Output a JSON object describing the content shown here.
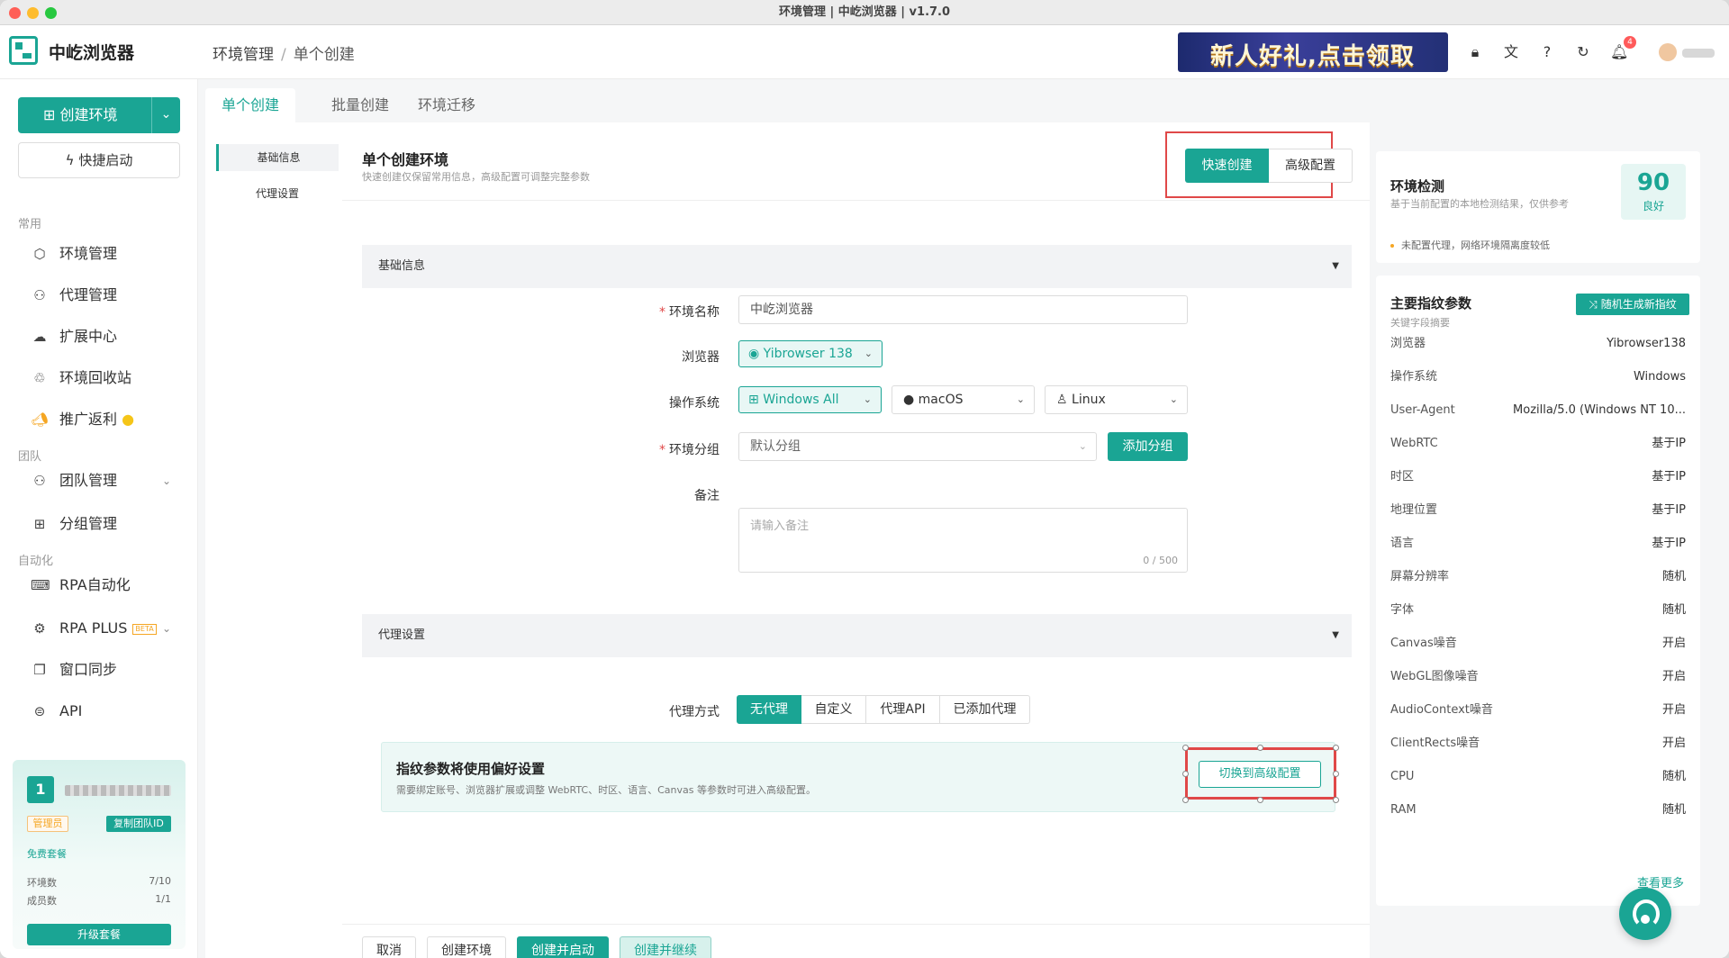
{
  "window": {
    "title": "环境管理 | 中屹浏览器 | v1.7.0"
  },
  "app": {
    "name": "中屹浏览器"
  },
  "breadcrumb": {
    "first": "环境管理",
    "sep": "/",
    "current": "单个创建"
  },
  "header": {
    "promo_text": "新人好礼,点击领取",
    "bell_count": "4"
  },
  "sidebar": {
    "create_label": "创建环境",
    "quick_label": "快捷启动",
    "sections": {
      "common": "常用",
      "team": "团队",
      "automation": "自动化"
    },
    "items": {
      "env": "环境管理",
      "proxy": "代理管理",
      "ext": "扩展中心",
      "recycle": "环境回收站",
      "promo": "推广返利",
      "team": "团队管理",
      "group": "分组管理",
      "rpa": "RPA自动化",
      "rpaplus": "RPA PLUS",
      "beta": "BETA",
      "sync": "窗口同步",
      "api": "API"
    },
    "team_card": {
      "num": "1",
      "role": "管理员",
      "copy": "复制团队ID",
      "plan": "免费套餐",
      "env_label": "环境数",
      "env_value": "7/10",
      "member_label": "成员数",
      "member_value": "1/1",
      "upgrade": "升级套餐"
    }
  },
  "tabs": [
    "单个创建",
    "批量创建",
    "环境迁移"
  ],
  "subnav": [
    "基础信息",
    "代理设置"
  ],
  "pane": {
    "title": "单个创建环境",
    "subtitle": "快速创建仅保留常用信息，高级配置可调整完整参数",
    "mode_quick": "快速创建",
    "mode_adv": "高级配置"
  },
  "basic": {
    "section": "基础信息",
    "name_label": "环境名称",
    "name_value": "中屹浏览器",
    "browser_label": "浏览器",
    "browser_value": "Yibrowser 138",
    "os_label": "操作系统",
    "os_win": "Windows All",
    "os_mac": "macOS",
    "os_linux": "Linux",
    "group_label": "环境分组",
    "group_value": "默认分组",
    "add_group": "添加分组",
    "note_label": "备注",
    "note_placeholder": "请输入备注",
    "note_count": "0 / 500"
  },
  "proxy": {
    "section": "代理设置",
    "mode_label": "代理方式",
    "options": [
      "无代理",
      "自定义",
      "代理API",
      "已添加代理"
    ],
    "notice_title": "指纹参数将使用偏好设置",
    "notice_sub": "需要绑定账号、浏览器扩展或调整 WebRTC、时区、语言、Canvas 等参数时可进入高级配置。",
    "switch_btn": "切换到高级配置"
  },
  "footer": {
    "cancel": "取消",
    "create": "创建环境",
    "create_launch": "创建并启动",
    "create_continue": "创建并继续"
  },
  "env_check": {
    "title": "环境检测",
    "subtitle": "基于当前配置的本地检测结果，仅供参考",
    "score": "90",
    "grade": "良好",
    "warning": "未配置代理，网络环境隔离度较低"
  },
  "fingerprint": {
    "title": "主要指纹参数",
    "subtitle": "关键字段摘要",
    "random_btn": "随机生成新指纹",
    "rows": [
      {
        "k": "浏览器",
        "v": "Yibrowser138"
      },
      {
        "k": "操作系统",
        "v": "Windows"
      },
      {
        "k": "User-Agent",
        "v": "Mozilla/5.0 (Windows NT 10..."
      },
      {
        "k": "WebRTC",
        "v": "基于IP"
      },
      {
        "k": "时区",
        "v": "基于IP"
      },
      {
        "k": "地理位置",
        "v": "基于IP"
      },
      {
        "k": "语言",
        "v": "基于IP"
      },
      {
        "k": "屏幕分辨率",
        "v": "随机"
      },
      {
        "k": "字体",
        "v": "随机"
      },
      {
        "k": "Canvas噪音",
        "v": "开启"
      },
      {
        "k": "WebGL图像噪音",
        "v": "开启"
      },
      {
        "k": "AudioContext噪音",
        "v": "开启"
      },
      {
        "k": "ClientRects噪音",
        "v": "开启"
      },
      {
        "k": "CPU",
        "v": "随机"
      },
      {
        "k": "RAM",
        "v": "随机"
      }
    ],
    "more": "查看更多"
  },
  "colors": {
    "accent": "#1aa594",
    "alert": "#e04848"
  }
}
